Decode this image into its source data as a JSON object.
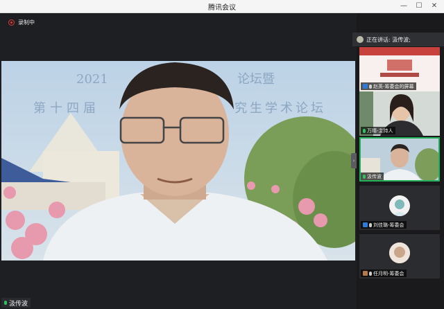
{
  "window": {
    "title": "腾讯会议",
    "minimize": "—",
    "maximize": "☐",
    "close": "✕"
  },
  "recording": {
    "label": "录制中"
  },
  "main_video": {
    "background_title_line1": "2021",
    "background_title_line1b": "论坛暨",
    "background_title_line2": "第十四届",
    "background_title_line2b": "究生学术论坛"
  },
  "current_speaker": {
    "name": "汲传波"
  },
  "speaking_banner": {
    "text": "正在讲话: 汲传波;"
  },
  "participants": [
    {
      "name": "赵英-筹委会的屏幕",
      "type": "screen",
      "mic": "off"
    },
    {
      "name": "万晴-主持人",
      "type": "video",
      "mic": "on"
    },
    {
      "name": "汲传波",
      "type": "video",
      "mic": "on",
      "active": true
    },
    {
      "name": "刘佳璐-筹委会",
      "type": "avatar",
      "mic": "off"
    },
    {
      "name": "任月明-筹委会",
      "type": "avatar",
      "mic": "off"
    }
  ],
  "colors": {
    "accent": "#23b15a",
    "record": "#e03a3a"
  }
}
